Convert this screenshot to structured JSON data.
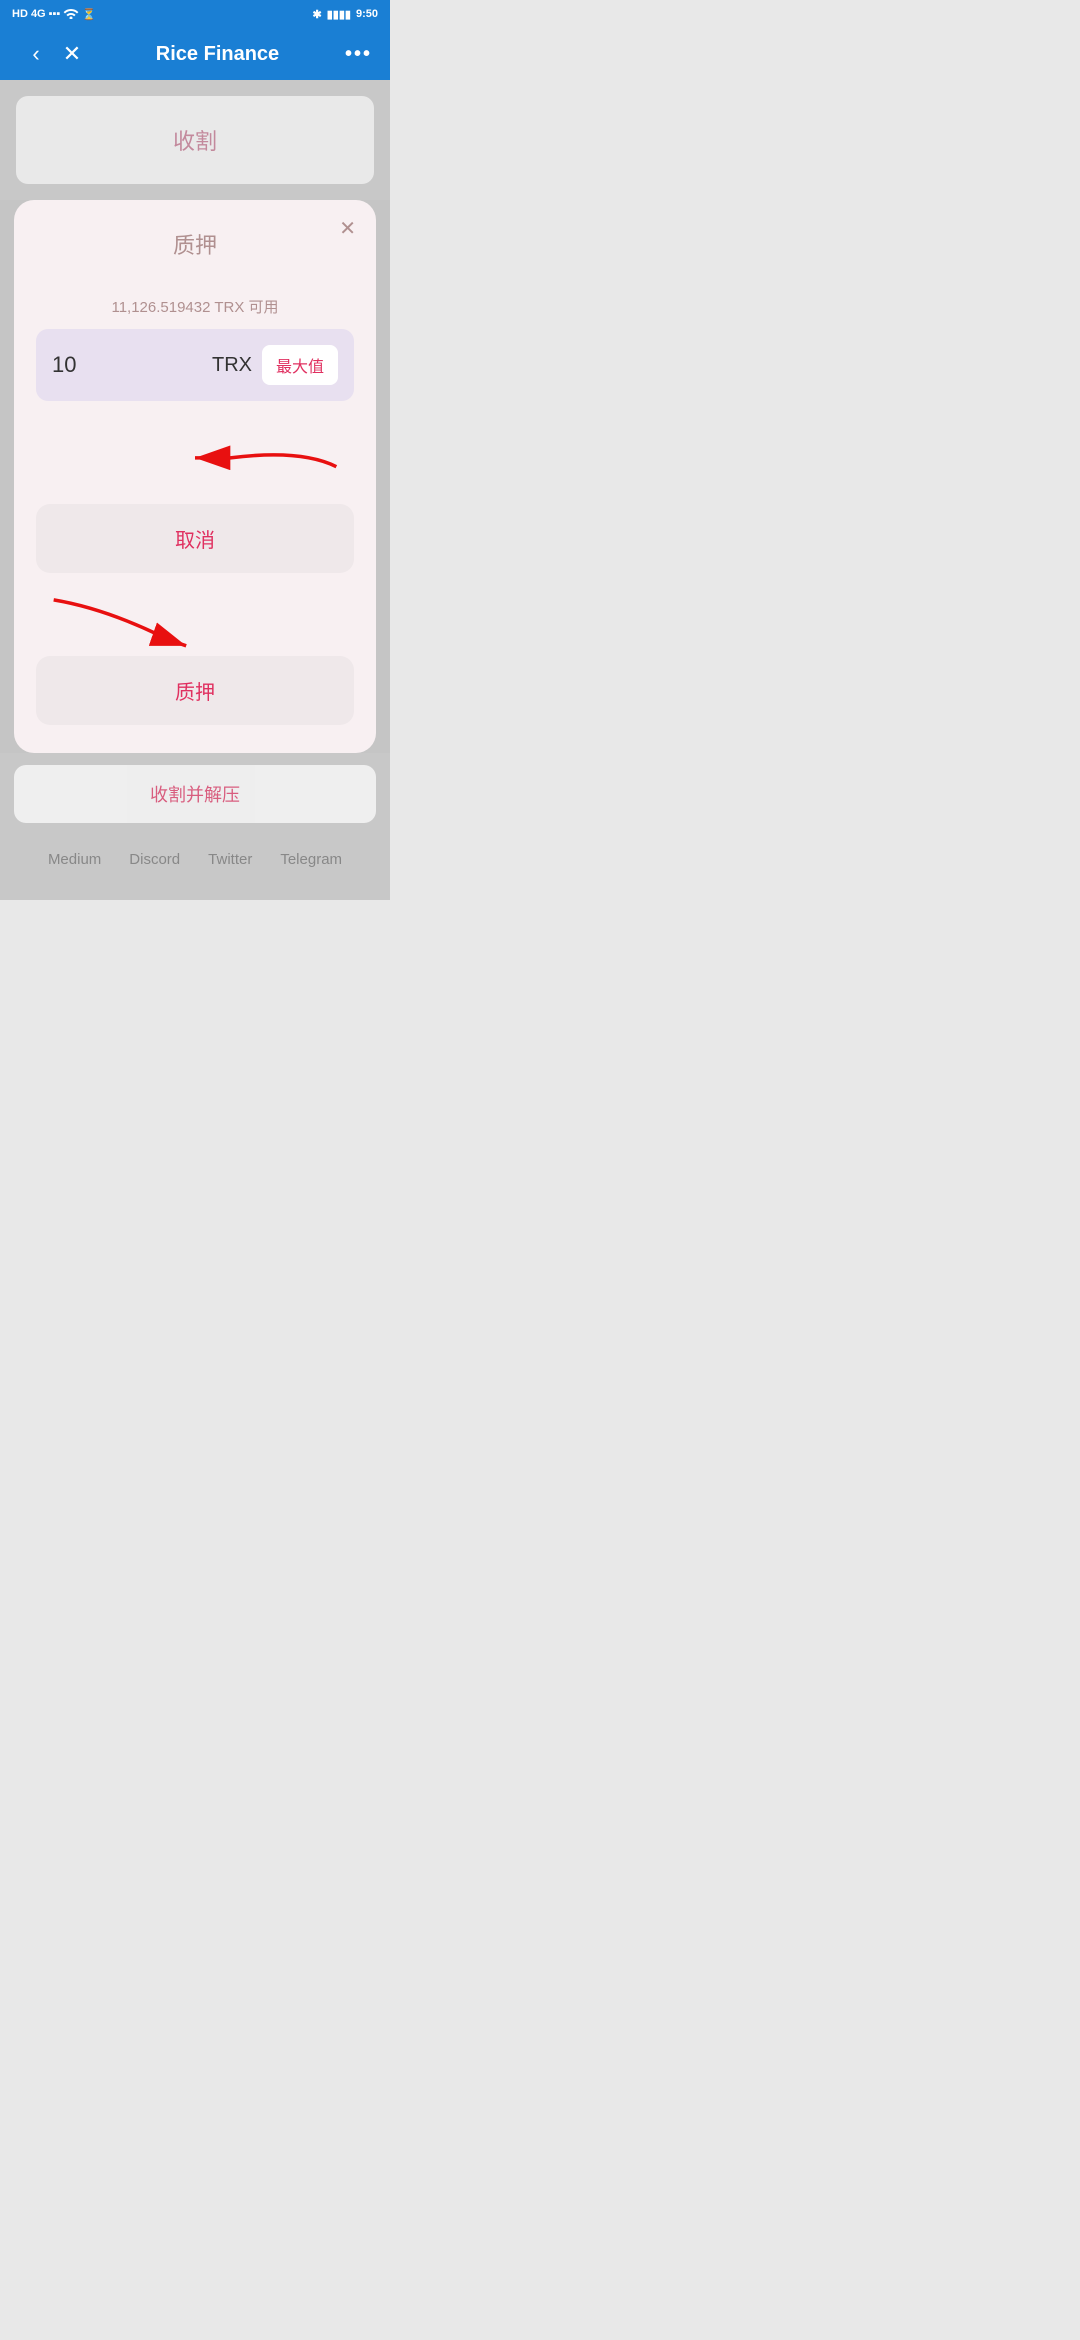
{
  "statusBar": {
    "left": "HD 4G",
    "time": "9:50"
  },
  "header": {
    "title": "Rice Finance",
    "back": "‹",
    "close": "✕",
    "more": "•••"
  },
  "bgCard": {
    "text": "收割"
  },
  "modal": {
    "title": "质押",
    "closeIcon": "✕",
    "availableText": "11,126.519432 TRX 可用",
    "inputValue": "10",
    "currency": "TRX",
    "maxButton": "最大值",
    "cancelButton": "取消",
    "pledgeButton": "质押"
  },
  "bottomCard": {
    "text": "收割并解压"
  },
  "footer": {
    "links": [
      "Medium",
      "Discord",
      "Twitter",
      "Telegram"
    ]
  }
}
